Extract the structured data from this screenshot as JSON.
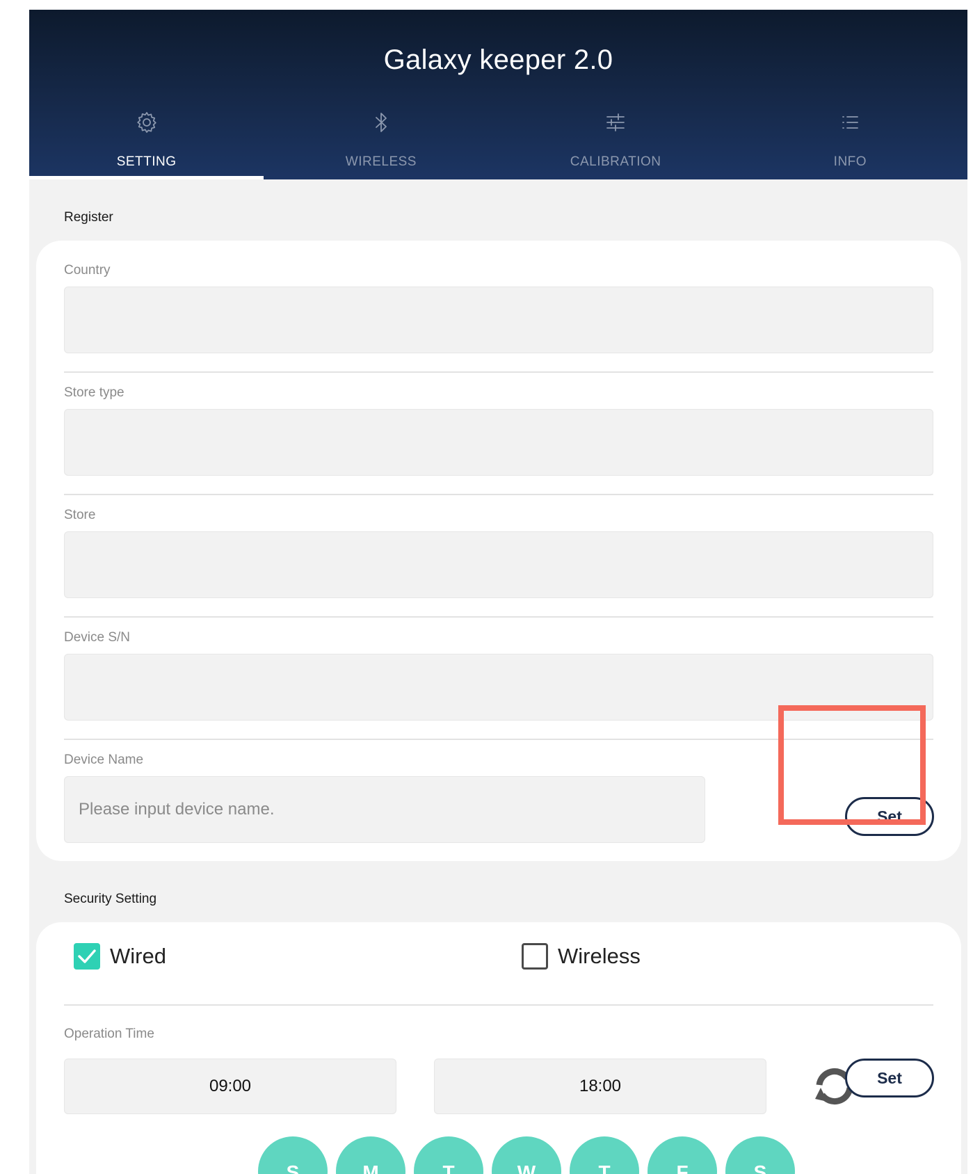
{
  "app": {
    "title": "Galaxy keeper 2.0"
  },
  "tabs": [
    {
      "label": "SETTING",
      "icon": "gear-icon",
      "active": true
    },
    {
      "label": "WIRELESS",
      "icon": "bluetooth-icon",
      "active": false
    },
    {
      "label": "CALIBRATION",
      "icon": "sliders-icon",
      "active": false
    },
    {
      "label": "INFO",
      "icon": "list-icon",
      "active": false
    }
  ],
  "register": {
    "title": "Register",
    "fields": {
      "country": {
        "label": "Country",
        "value": ""
      },
      "store_type": {
        "label": "Store type",
        "value": ""
      },
      "store": {
        "label": "Store",
        "value": ""
      },
      "device_sn": {
        "label": "Device S/N",
        "value": ""
      },
      "device_name": {
        "label": "Device Name",
        "value": "",
        "placeholder": "Please input device name."
      }
    },
    "set_label": "Set"
  },
  "security": {
    "title": "Security Setting",
    "wired": {
      "label": "Wired",
      "checked": true
    },
    "wireless": {
      "label": "Wireless",
      "checked": false
    },
    "operation_time": {
      "label": "Operation Time",
      "start": "09:00",
      "separator": "~",
      "end": "18:00",
      "set_label": "Set"
    },
    "days": [
      "S",
      "M",
      "T",
      "W",
      "T",
      "F",
      "S"
    ]
  },
  "colors": {
    "header_top": "#0d1a2d",
    "header_bottom": "#1c3563",
    "accent_teal": "#2ed1b4",
    "day_circle": "#5fd6c0",
    "button_border": "#1c2c4a",
    "highlight": "#f4695a"
  }
}
